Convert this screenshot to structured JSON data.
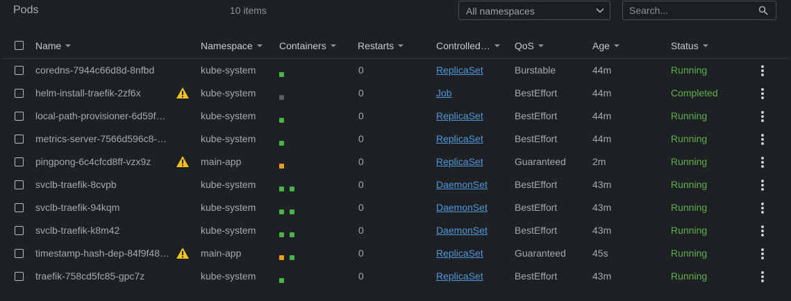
{
  "header": {
    "title": "Pods",
    "count": "10 items",
    "namespace_select": "All namespaces",
    "search_placeholder": "Search..."
  },
  "columns": [
    "Name",
    "Namespace",
    "Containers",
    "Restarts",
    "Controlled…",
    "QoS",
    "Age",
    "Status"
  ],
  "colors": {
    "accent_link": "#4e96d9",
    "status_running": "#5fb04b",
    "container_ok": "#48b547",
    "container_pending": "#f39c1c",
    "container_terminated": "#5a5d61",
    "warning": "#f2c21b"
  },
  "rows": [
    {
      "name": "coredns-7944c66d8d-8nfbd",
      "warning": false,
      "namespace": "kube-system",
      "containers": [
        "green"
      ],
      "restarts": "0",
      "controlled_by": "ReplicaSet",
      "qos": "Burstable",
      "age": "44m",
      "status": "Running"
    },
    {
      "name": "helm-install-traefik-2zf6x",
      "warning": true,
      "namespace": "kube-system",
      "containers": [
        "gray"
      ],
      "restarts": "0",
      "controlled_by": "Job",
      "qos": "BestEffort",
      "age": "44m",
      "status": "Completed"
    },
    {
      "name": "local-path-provisioner-6d59f4…",
      "warning": false,
      "namespace": "kube-system",
      "containers": [
        "green"
      ],
      "restarts": "0",
      "controlled_by": "ReplicaSet",
      "qos": "BestEffort",
      "age": "44m",
      "status": "Running"
    },
    {
      "name": "metrics-server-7566d596c8-g…",
      "warning": false,
      "namespace": "kube-system",
      "containers": [
        "green"
      ],
      "restarts": "0",
      "controlled_by": "ReplicaSet",
      "qos": "BestEffort",
      "age": "44m",
      "status": "Running"
    },
    {
      "name": "pingpong-6c4cfcd8ff-vzx9z",
      "warning": true,
      "namespace": "main-app",
      "containers": [
        "orange"
      ],
      "restarts": "0",
      "controlled_by": "ReplicaSet",
      "qos": "Guaranteed",
      "age": "2m",
      "status": "Running"
    },
    {
      "name": "svclb-traefik-8cvpb",
      "warning": false,
      "namespace": "kube-system",
      "containers": [
        "green",
        "green"
      ],
      "restarts": "0",
      "controlled_by": "DaemonSet",
      "qos": "BestEffort",
      "age": "43m",
      "status": "Running"
    },
    {
      "name": "svclb-traefik-94kqm",
      "warning": false,
      "namespace": "kube-system",
      "containers": [
        "green",
        "green"
      ],
      "restarts": "0",
      "controlled_by": "DaemonSet",
      "qos": "BestEffort",
      "age": "43m",
      "status": "Running"
    },
    {
      "name": "svclb-traefik-k8m42",
      "warning": false,
      "namespace": "kube-system",
      "containers": [
        "green",
        "green"
      ],
      "restarts": "0",
      "controlled_by": "DaemonSet",
      "qos": "BestEffort",
      "age": "43m",
      "status": "Running"
    },
    {
      "name": "timestamp-hash-dep-84f9f48…",
      "warning": true,
      "namespace": "main-app",
      "containers": [
        "orange",
        "green"
      ],
      "restarts": "0",
      "controlled_by": "ReplicaSet",
      "qos": "Guaranteed",
      "age": "45s",
      "status": "Running"
    },
    {
      "name": "traefik-758cd5fc85-gpc7z",
      "warning": false,
      "namespace": "kube-system",
      "containers": [
        "green"
      ],
      "restarts": "0",
      "controlled_by": "ReplicaSet",
      "qos": "BestEffort",
      "age": "43m",
      "status": "Running"
    }
  ]
}
